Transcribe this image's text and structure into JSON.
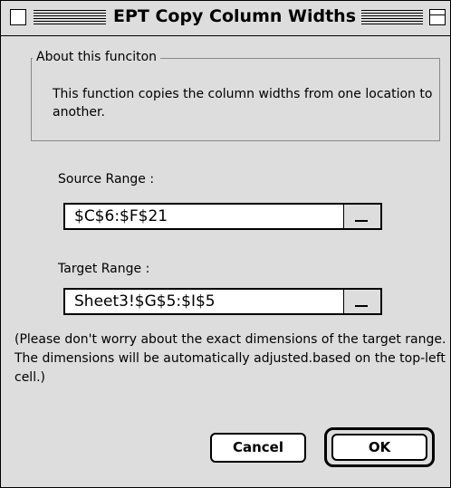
{
  "window": {
    "title": "EPT Copy Column Widths"
  },
  "about": {
    "group_label": "About this funciton",
    "text": "This function copies the column widths from one location to another."
  },
  "source": {
    "label": "Source Range :",
    "value": "$C$6:$F$21"
  },
  "target": {
    "label": "Target Range :",
    "value": "Sheet3!$G$5:$I$5"
  },
  "note": "(Please don't worry about the exact dimensions of the target range. The dimensions will be automatically adjusted.based on the top-left cell.)",
  "buttons": {
    "cancel": "Cancel",
    "ok": "OK"
  },
  "icons": {
    "close": "close-box-icon",
    "zoom": "zoom-box-icon",
    "dropdown": "range-collapse-icon"
  }
}
